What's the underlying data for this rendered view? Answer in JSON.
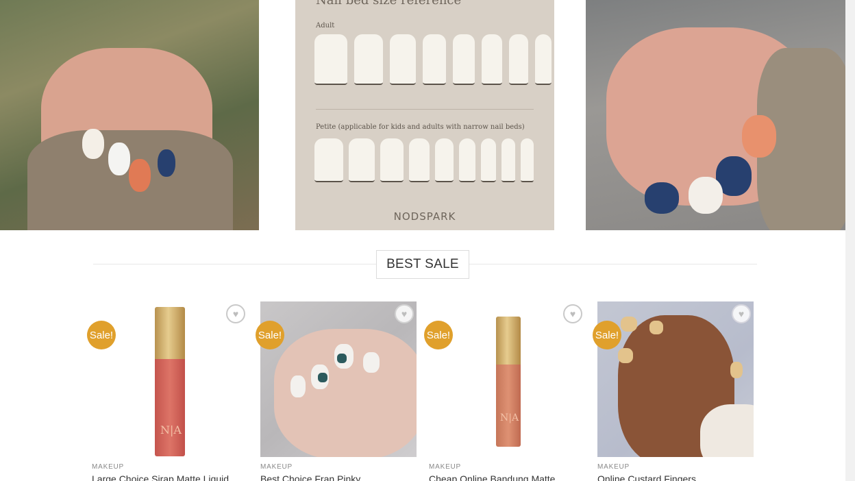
{
  "hero": {
    "ref_title": "Nail bed size reference",
    "adult_label": "Adult",
    "petite_label": "Petite (applicable for kids and adults with narrow nail beds)",
    "brand": "NODSPARK"
  },
  "section": {
    "title": "BEST SALE"
  },
  "products": [
    {
      "badge": "Sale!",
      "category": "MAKEUP",
      "name": "Large Choice Sirap Matte Liquid",
      "image_icon": "lip-gloss-tube-icon"
    },
    {
      "badge": "Sale!",
      "category": "MAKEUP",
      "name": "Best Choice Fran Pinky",
      "image_icon": "nail-art-photo"
    },
    {
      "badge": "Sale!",
      "category": "MAKEUP",
      "name": "Cheap Online Bandung Matte",
      "image_icon": "lip-gloss-tube-icon"
    },
    {
      "badge": "Sale!",
      "category": "MAKEUP",
      "name": "Online Custard Fingers",
      "image_icon": "nail-art-photo"
    }
  ],
  "colors": {
    "sale_badge": "#e0a02c",
    "accent_text": "#333333"
  }
}
